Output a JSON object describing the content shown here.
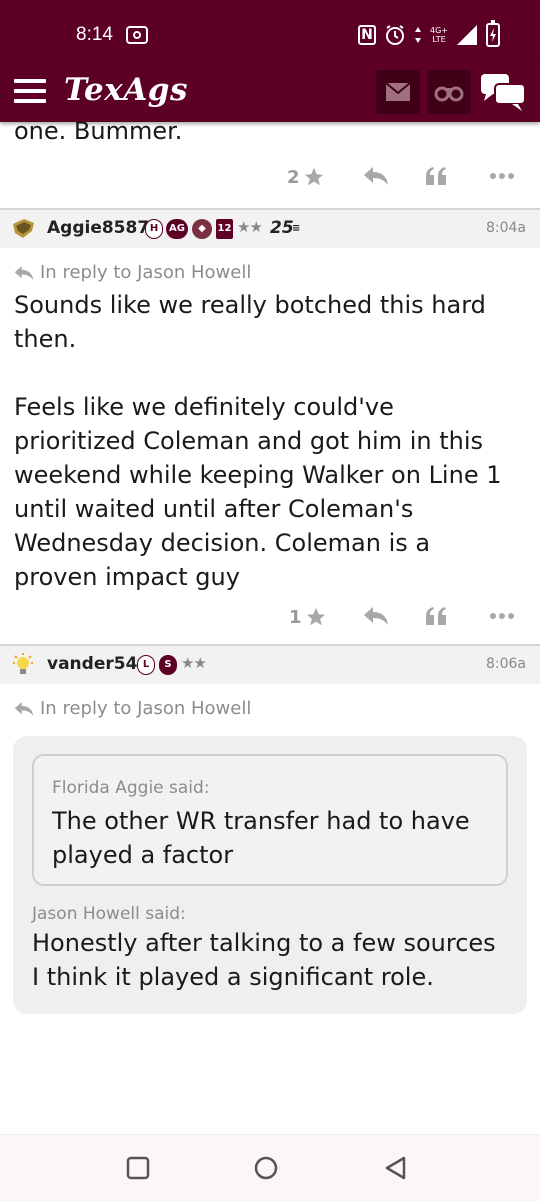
{
  "status_bar": {
    "time": "8:14",
    "network_top": "4G+",
    "network_bottom": "LTE"
  },
  "app_bar": {
    "logo": "TexAgs"
  },
  "prev_post": {
    "text_tail": "one. Bummer.",
    "star_count": "2"
  },
  "post1": {
    "username": "Aggie8587",
    "badge_h": "H",
    "badge_ag": "AG",
    "badge_num": "12",
    "stars": "★★",
    "badge_25": "25",
    "time": "8:04a",
    "reply_to": "In reply to Jason Howell",
    "text": "Sounds like we really botched this hard\nthen.\n\nFeels like we definitely could've\nprioritized Coleman and got him in this\nweekend while keeping Walker on Line 1\nuntil waited until after Coleman's\nWednesday decision. Coleman is a\nproven impact guy",
    "star_count": "1"
  },
  "post2": {
    "username": "vander54",
    "badge_l": "L",
    "badge_s": "S",
    "stars": "★★",
    "time": "8:06a",
    "reply_to": "In reply to Jason Howell",
    "quote_inner_author": "Florida Aggie said:",
    "quote_inner_text": "The other WR transfer had to have played a factor",
    "quote_outer_author": "Jason Howell said:",
    "quote_outer_text": "Honestly after talking to a few sources I think it played a significant role."
  },
  "colors": {
    "brand": "#5c0025",
    "brand_dark": "#3f0018",
    "muted": "#9a9a9a"
  }
}
